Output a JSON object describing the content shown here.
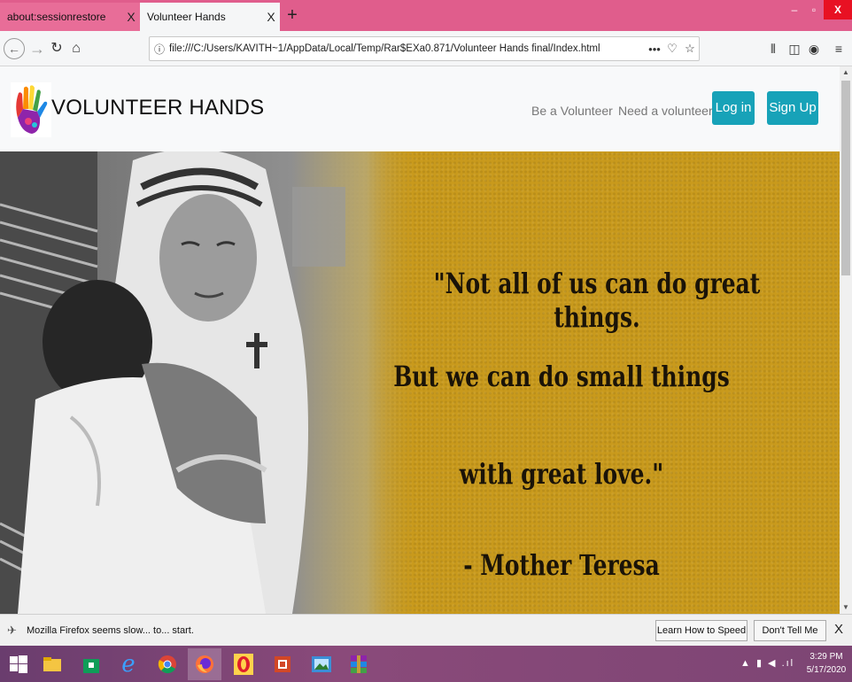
{
  "browser": {
    "tabs": [
      {
        "label": "about:sessionrestore",
        "close": "X"
      },
      {
        "label": "Volunteer Hands",
        "close": "X"
      }
    ],
    "new_tab": "+",
    "window_controls": {
      "minimize": "–",
      "maximize": "▫",
      "close": "X"
    },
    "url": "file:///C:/Users/KAVITH~1/AppData/Local/Temp/Rar$EXa0.871/Volunteer Hands final/Index.html",
    "url_icons": [
      "info-icon",
      "more-icon",
      "pocket-icon",
      "bookmark-star-icon"
    ],
    "toolbar_right_icons": [
      "library-icon",
      "sidebar-icon",
      "account-icon",
      "menu-icon"
    ],
    "colors": {
      "tab_strip": "#e05d8c",
      "close_button": "#e81123"
    }
  },
  "site": {
    "brand": "VOLUNTEER HANDS",
    "nav": [
      {
        "label": "Be a Volunteer"
      },
      {
        "label": "Need a volunteer"
      }
    ],
    "buttons": {
      "login": "Log in",
      "signup": "Sign Up"
    },
    "button_color": "#17a2b8",
    "hero": {
      "quote_line1": "\"Not all of us can do great things.",
      "quote_line2": "But we can do small things",
      "quote_line3": "with great love.\"",
      "attribution": "- Mother Teresa",
      "background_color": "#c99a1c"
    }
  },
  "notification": {
    "message": "Mozilla Firefox seems slow... to... start.",
    "learn_button": "Learn How to Speed It Up",
    "dismiss_button": "Don't Tell Me Again",
    "close": "X"
  },
  "taskbar": {
    "apps": [
      "windows-start",
      "file-explorer",
      "store",
      "edge",
      "chrome",
      "firefox",
      "opera",
      "powerpoint",
      "photos",
      "winrar"
    ],
    "tray": "▲ ▮ ◀ .ıl",
    "time": "3:29 PM",
    "date": "5/17/2020"
  }
}
